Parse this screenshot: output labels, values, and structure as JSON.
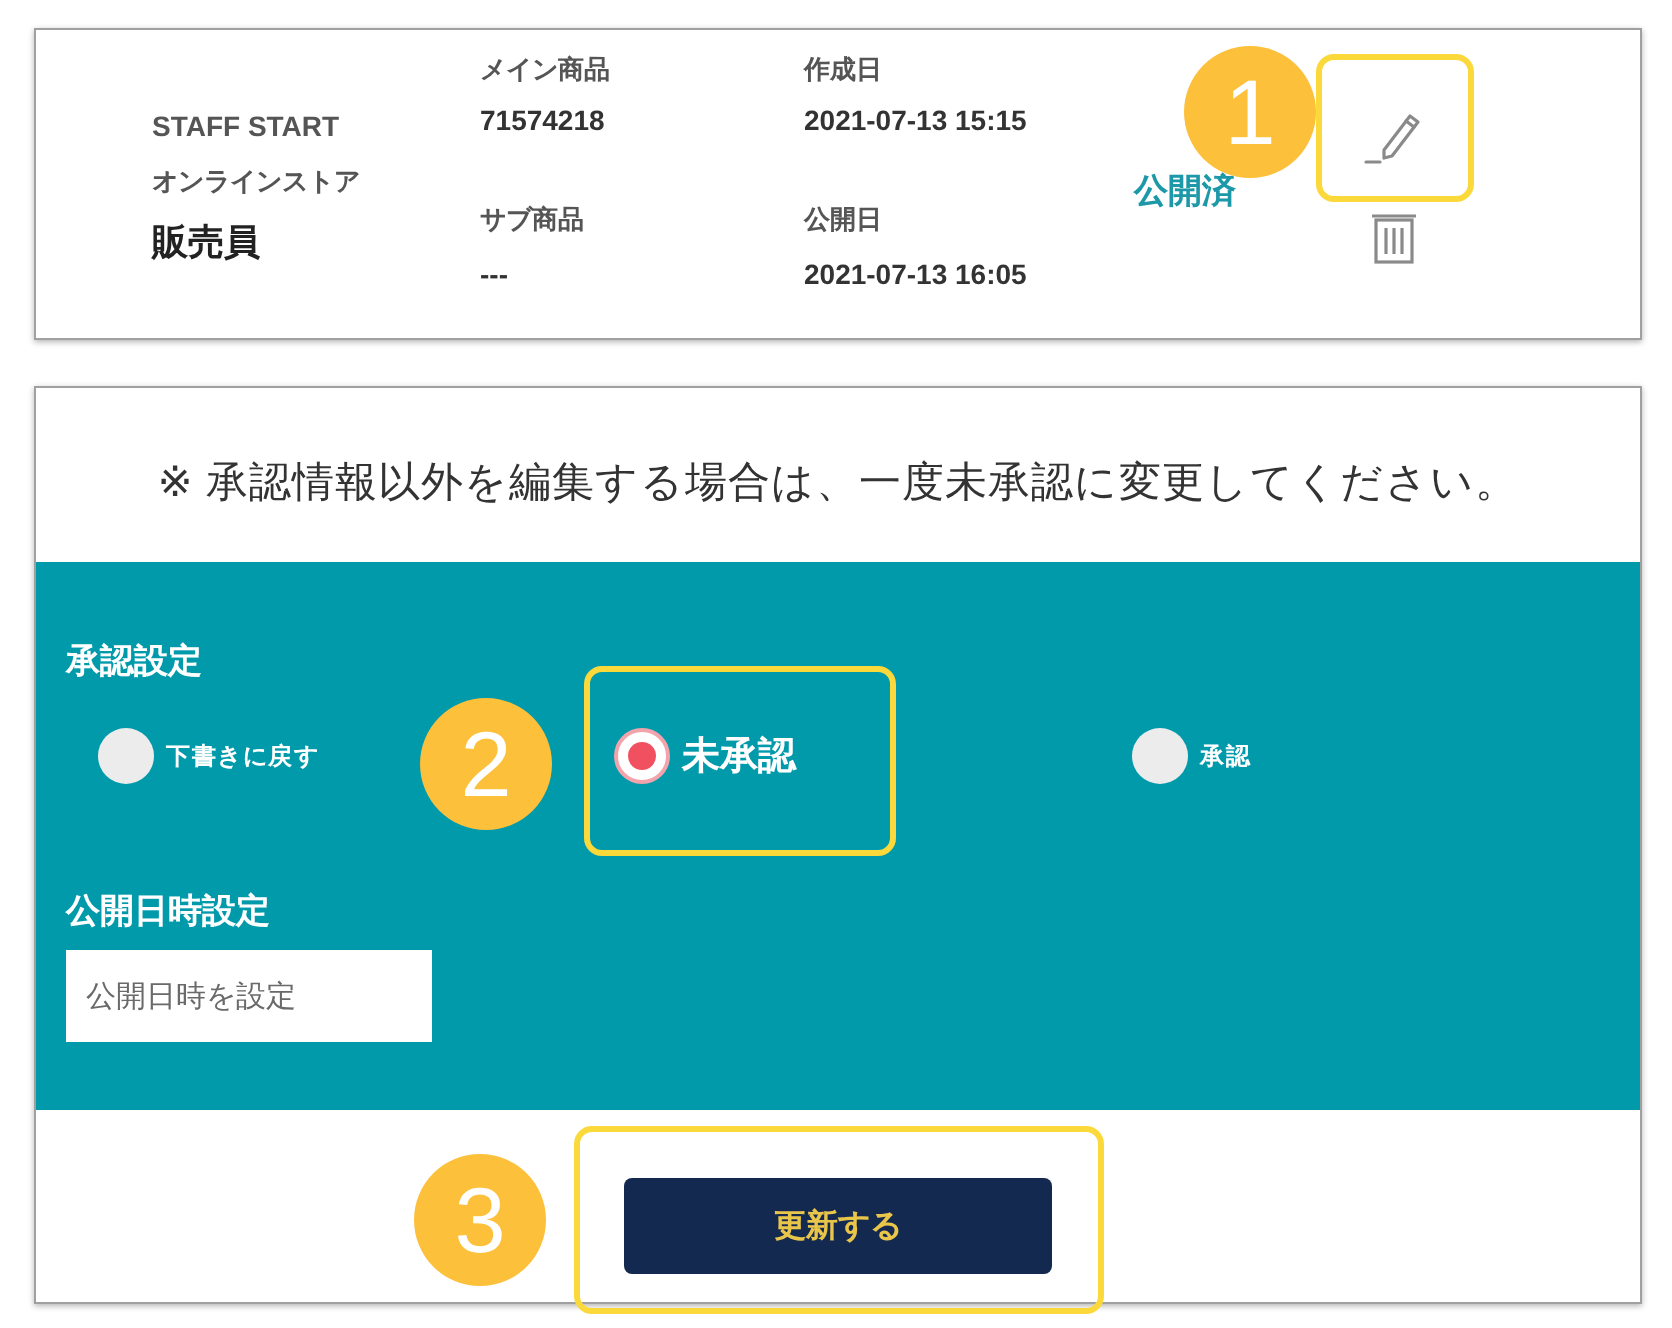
{
  "post_card": {
    "store_name": "STAFF START",
    "store_type": "オンラインストア",
    "role": "販売員",
    "detail_columns": [
      {
        "items": [
          {
            "label": "メイン商品",
            "value": "71574218"
          },
          {
            "label": "サブ商品",
            "value": "---"
          }
        ]
      },
      {
        "items": [
          {
            "label": "作成日",
            "value": "2021-07-13 15:15"
          },
          {
            "label": "公開日",
            "value": "2021-07-13 16:05"
          }
        ]
      }
    ],
    "status": "公開済"
  },
  "edit_panel": {
    "note": "※ 承認情報以外を編集する場合は、一度未承認に変更してください。",
    "approval": {
      "label": "承認設定",
      "options": [
        {
          "label": "下書きに戻す",
          "selected": false
        },
        {
          "label": "未承認",
          "selected": true
        },
        {
          "label": "承認",
          "selected": false
        }
      ]
    },
    "publish_datetime": {
      "label": "公開日時設定",
      "placeholder": "公開日時を設定"
    },
    "submit_button": "更新する"
  },
  "annotations": [
    {
      "number": "1"
    },
    {
      "number": "2"
    },
    {
      "number": "3"
    }
  ]
}
